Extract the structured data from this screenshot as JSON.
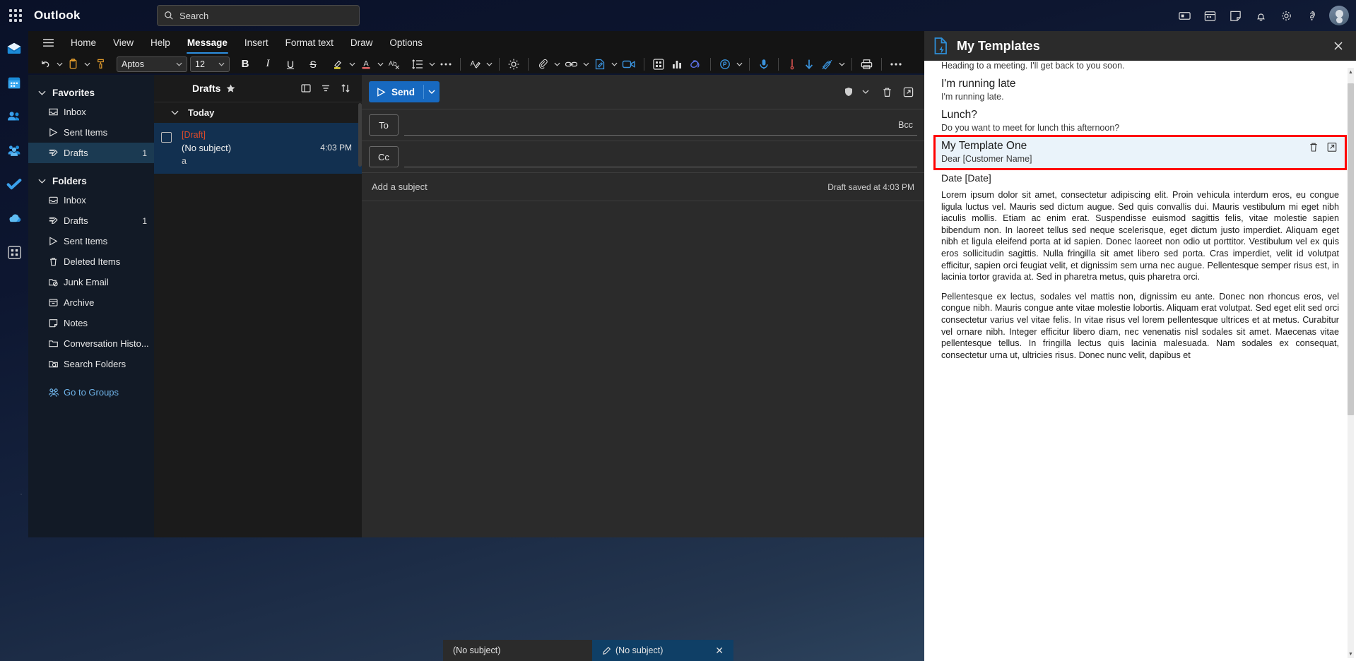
{
  "topbar": {
    "app_launcher": "app-launcher",
    "brand": "Outlook",
    "search_placeholder": "Search",
    "icons": [
      "rooms-icon",
      "calendar-top-icon",
      "notes-icon",
      "bell-icon",
      "gear-icon",
      "help-icon",
      "account-avatar"
    ]
  },
  "rail": {
    "items": [
      {
        "name": "mail",
        "label": "Mail",
        "active": true
      },
      {
        "name": "calendar",
        "label": "Calendar",
        "active": false
      },
      {
        "name": "people",
        "label": "People",
        "active": false
      },
      {
        "name": "groups",
        "label": "Groups",
        "active": false
      },
      {
        "name": "to-do",
        "label": "To Do",
        "active": false
      },
      {
        "name": "onedrive",
        "label": "OneDrive",
        "active": false
      },
      {
        "name": "apps",
        "label": "Apps",
        "active": false
      }
    ]
  },
  "ribbon": {
    "tabs": [
      {
        "label": "Home",
        "active": false
      },
      {
        "label": "View",
        "active": false
      },
      {
        "label": "Help",
        "active": false
      },
      {
        "label": "Message",
        "active": true
      },
      {
        "label": "Insert",
        "active": false
      },
      {
        "label": "Format text",
        "active": false
      },
      {
        "label": "Draw",
        "active": false
      },
      {
        "label": "Options",
        "active": false
      }
    ],
    "font_name": "Aptos",
    "font_size": "12",
    "tools": [
      "undo",
      "paste",
      "format-painter",
      "bold",
      "italic",
      "underline",
      "strikethrough",
      "highlight",
      "font-color",
      "clear-formatting",
      "line-spacing",
      "more-formatting",
      "editor",
      "immersive-reader",
      "attach",
      "link",
      "signature",
      "video",
      "apps",
      "poll",
      "loop",
      "viva-insights",
      "dictate",
      "high-importance",
      "low-importance",
      "sensitivity",
      "print",
      "more-options"
    ]
  },
  "folders": {
    "favorites_label": "Favorites",
    "favorites": [
      {
        "label": "Inbox",
        "icon": "inbox-icon",
        "count": "",
        "selected": false
      },
      {
        "label": "Sent Items",
        "icon": "send-icon",
        "count": "",
        "selected": false
      },
      {
        "label": "Drafts",
        "icon": "draft-pencil-icon",
        "count": "1",
        "selected": true
      }
    ],
    "folders_label": "Folders",
    "items": [
      {
        "label": "Inbox",
        "icon": "inbox-icon",
        "count": ""
      },
      {
        "label": "Drafts",
        "icon": "draft-pencil-icon",
        "count": "1"
      },
      {
        "label": "Sent Items",
        "icon": "send-icon",
        "count": ""
      },
      {
        "label": "Deleted Items",
        "icon": "trash-icon",
        "count": ""
      },
      {
        "label": "Junk Email",
        "icon": "junk-folder-icon",
        "count": ""
      },
      {
        "label": "Archive",
        "icon": "archive-icon",
        "count": ""
      },
      {
        "label": "Notes",
        "icon": "note-icon",
        "count": ""
      },
      {
        "label": "Conversation Histo...",
        "icon": "folder-icon",
        "count": ""
      },
      {
        "label": "Search Folders",
        "icon": "search-folder-icon",
        "count": ""
      }
    ],
    "groups_link": "Go to Groups"
  },
  "messagelist": {
    "title": "Drafts",
    "star_icon": "star-icon",
    "actions": [
      "reading-pane-icon",
      "filter-icon",
      "sort-icon"
    ],
    "group_label": "Today",
    "messages": [
      {
        "draft_tag": "[Draft]",
        "subject": "(No subject)",
        "preview": "a",
        "time": "4:03 PM",
        "selected": true
      }
    ]
  },
  "compose": {
    "send_label": "Send",
    "send_dropdown": "send-options-icon",
    "actions": [
      "sensitivity-shield-icon",
      "discard-icon",
      "popout-icon"
    ],
    "to_label": "To",
    "cc_label": "Cc",
    "bcc_label": "Bcc",
    "subject_placeholder": "Add a subject",
    "saved_status": "Draft saved at 4:03 PM"
  },
  "templates": {
    "panel_icon": "my-templates-icon",
    "title": "My Templates",
    "close_icon": "close-icon",
    "items": [
      {
        "name": "",
        "desc": "Heading to a meeting. I'll get back to you soon.",
        "highlight": false,
        "partial": true
      },
      {
        "name": "I'm running late",
        "desc": "I'm running late.",
        "highlight": false,
        "partial": false
      },
      {
        "name": "Lunch?",
        "desc": "Do you want to meet for lunch this afternoon?",
        "highlight": false,
        "partial": false
      },
      {
        "name": "My Template One",
        "desc": "Dear [Customer Name]",
        "highlight": true,
        "partial": false,
        "edit_icon": "edit-icon",
        "delete_icon": "delete-icon"
      }
    ],
    "date_line": "Date [Date]",
    "body_paragraphs": [
      "Lorem ipsum dolor sit amet, consectetur adipiscing elit. Proin vehicula interdum eros, eu congue ligula luctus vel. Mauris sed dictum augue. Sed quis convallis dui. Mauris vestibulum mi eget nibh iaculis mollis. Etiam ac enim erat. Suspendisse euismod sagittis felis, vitae molestie sapien bibendum non. In laoreet tellus sed neque scelerisque, eget dictum justo imperdiet. Aliquam eget nibh et ligula eleifend porta at id sapien. Donec laoreet non odio ut porttitor. Vestibulum vel ex quis eros sollicitudin sagittis. Nulla fringilla sit amet libero sed porta. Cras imperdiet, velit id volutpat efficitur, sapien orci feugiat velit, et dignissim sem urna nec augue. Pellentesque semper risus est, in lacinia tortor gravida at. Sed in pharetra metus, quis pharetra orci.",
      "Pellentesque ex lectus, sodales vel mattis non, dignissim eu ante. Donec non rhoncus eros, vel congue nibh. Mauris congue ante vitae molestie lobortis. Aliquam erat volutpat. Sed eget elit sed orci consectetur varius vel vitae felis. In vitae risus vel lorem pellentesque ultrices et at metus. Curabitur vel ornare nibh. Integer efficitur libero diam, nec venenatis nisl sodales sit amet. Maecenas vitae pellentesque tellus. In fringilla lectus quis lacinia malesuada. Nam sodales ex consequat, consectetur urna ut, ultricies risus. Donec nunc velit, dapibus et"
    ]
  },
  "taskbar": {
    "windows": [
      {
        "label": "(No subject)",
        "active": false
      },
      {
        "label": "(No subject)",
        "active": true,
        "pen": "pen-icon",
        "close": "close-icon"
      }
    ]
  },
  "colors": {
    "accent": "#1769c0",
    "selection": "#123050",
    "highlight_outline": "#ff0000",
    "draft_red": "#e04b2a",
    "link_blue": "#6fb3e8"
  }
}
